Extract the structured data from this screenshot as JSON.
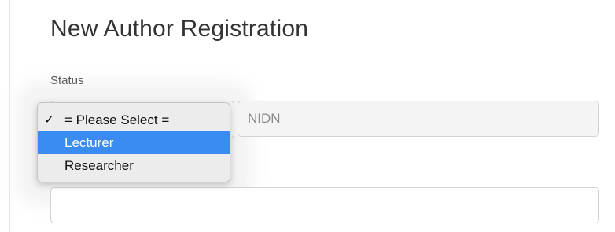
{
  "page": {
    "title": "New Author Registration"
  },
  "form": {
    "status_label": "Status",
    "status_select": {
      "options": [
        {
          "label": "= Please Select =",
          "checked": true,
          "highlighted": false
        },
        {
          "label": "Lecturer",
          "checked": false,
          "highlighted": true
        },
        {
          "label": "Researcher",
          "checked": false,
          "highlighted": false
        }
      ],
      "check_icon": "checkmark-icon"
    },
    "nidn_input": {
      "placeholder": "NIDN",
      "value": ""
    },
    "second_input": {
      "value": ""
    }
  },
  "colors": {
    "highlight": "#3a8bf2",
    "title_text": "#333333"
  }
}
